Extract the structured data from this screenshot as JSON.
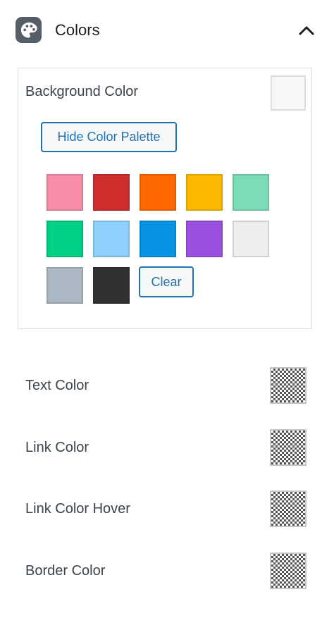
{
  "panel": {
    "title": "Colors",
    "icon": "palette-icon",
    "collapse_icon": "chevron-up-icon"
  },
  "background_color": {
    "label": "Background Color",
    "current_value": "#f6f7f7",
    "hide_palette_label": "Hide Color Palette",
    "clear_label": "Clear",
    "palette": [
      {
        "name": "pink",
        "hex": "#f78da7"
      },
      {
        "name": "red",
        "hex": "#cf2e2e"
      },
      {
        "name": "orange",
        "hex": "#ff6900"
      },
      {
        "name": "amber",
        "hex": "#fcb900"
      },
      {
        "name": "light-green",
        "hex": "#7bdcb5"
      },
      {
        "name": "green",
        "hex": "#00d084"
      },
      {
        "name": "light-blue",
        "hex": "#8ed1fc"
      },
      {
        "name": "blue",
        "hex": "#0693e3"
      },
      {
        "name": "purple",
        "hex": "#9b51e0"
      },
      {
        "name": "light-gray",
        "hex": "#eeeeee"
      },
      {
        "name": "gray",
        "hex": "#abb8c3"
      },
      {
        "name": "dark-gray",
        "hex": "#313131"
      }
    ]
  },
  "colors": [
    {
      "label": "Text Color",
      "value": "transparent"
    },
    {
      "label": "Link Color",
      "value": "transparent"
    },
    {
      "label": "Link Color Hover",
      "value": "transparent"
    },
    {
      "label": "Border Color",
      "value": "transparent"
    }
  ],
  "theme": {
    "accent": "#2271b1",
    "icon_bg": "#555d66",
    "text": "#3c434a"
  }
}
